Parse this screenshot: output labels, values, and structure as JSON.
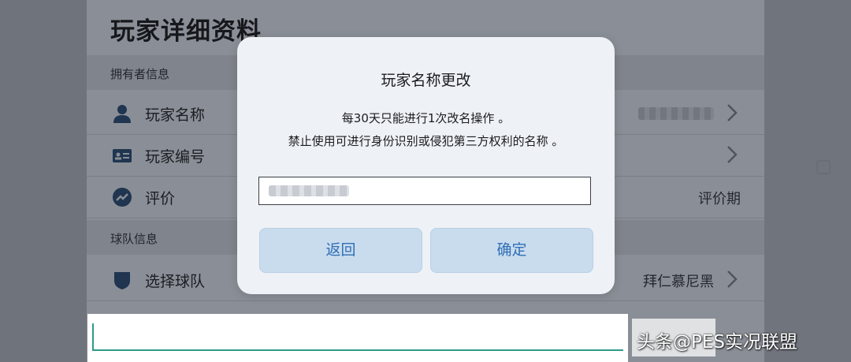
{
  "page": {
    "title": "玩家详细资料",
    "sections": {
      "owner": "拥有者信息",
      "team": "球队信息"
    },
    "rows": {
      "player_name": "玩家名称",
      "player_id": "玩家编号",
      "rating": "评价",
      "rating_value": "评价期",
      "select_team": "选择球队",
      "team_value": "拜仁慕尼黑"
    }
  },
  "dialog": {
    "title": "玩家名称更改",
    "line1": "每30天只能进行1次改名操作 。",
    "line2": "禁止使用可进行身份识别或侵犯第三方权利的名称 。",
    "back_label": "返回",
    "confirm_label": "确定"
  },
  "watermark": "头条@PES实况联盟",
  "colors": {
    "accent": "#2f6fb6",
    "button_bg": "#c9dcee",
    "input_line": "#2f9a8a"
  }
}
